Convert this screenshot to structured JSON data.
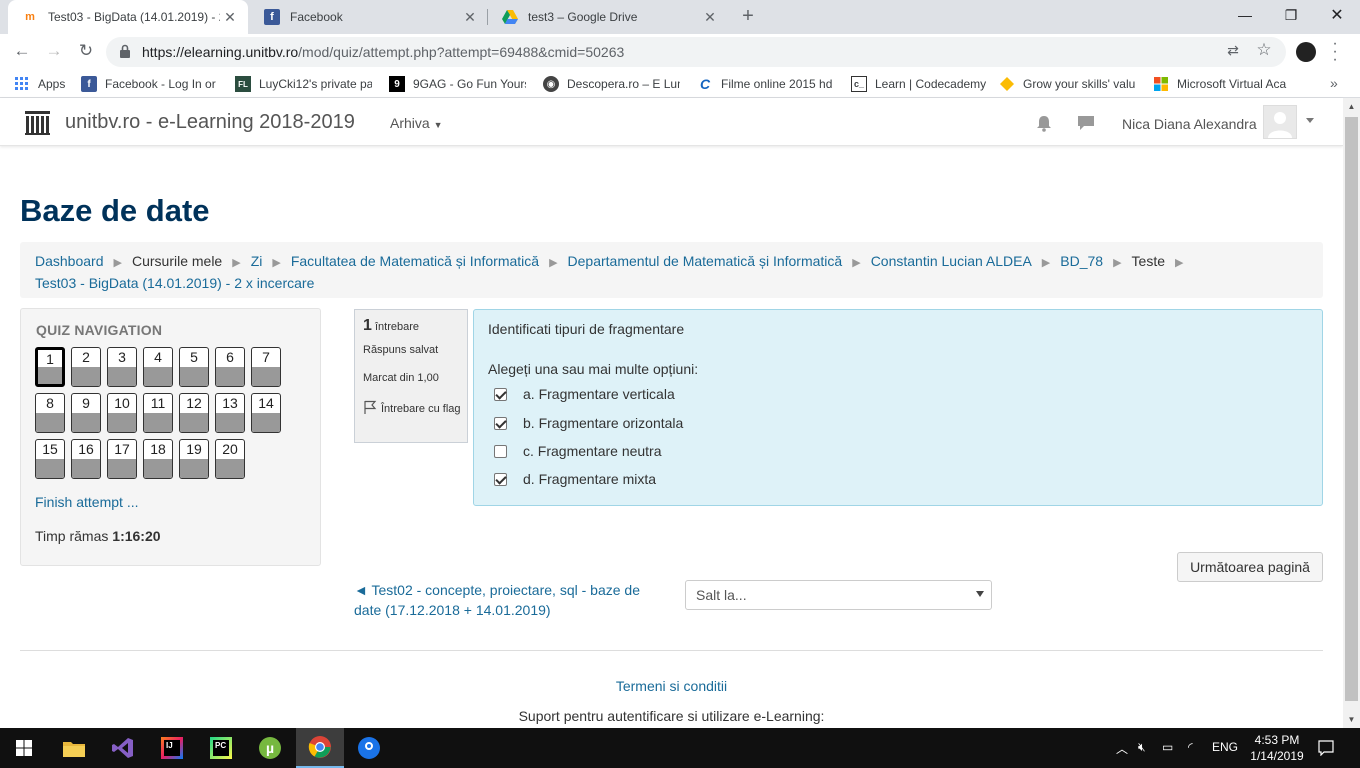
{
  "browser": {
    "tabs": [
      {
        "title": "Test03 - BigData (14.01.2019) - 2",
        "active": true
      },
      {
        "title": "Facebook",
        "active": false
      },
      {
        "title": "test3 – Google Drive",
        "active": false
      }
    ],
    "url_host": "https://elearning.unitbv.ro",
    "url_path": "/mod/quiz/attempt.php?attempt=69488&cmid=50263",
    "bookmarks": [
      "Apps",
      "Facebook - Log In or",
      "LuyCki12's private pa",
      "9GAG - Go Fun Yours",
      "Descopera.ro – E Lum",
      "Filme online 2015 hd",
      "Learn | Codecademy",
      "Grow your skills' valu",
      "Microsoft Virtual Aca"
    ]
  },
  "navbar": {
    "brand": "unitbv.ro - e-Learning 2018-2019",
    "menu": "Arhiva",
    "user_name": "Nica Diana Alexandra"
  },
  "page": {
    "title": "Baze de date",
    "breadcrumb": {
      "dashboard": "Dashboard",
      "my_courses": "Cursurile mele",
      "zi": "Zi",
      "faculty": "Facultatea de Matematică și Informatică",
      "department": "Departamentul de Matematică și Informatică",
      "teacher": "Constantin Lucian ALDEA",
      "course": "BD_78",
      "tests": "Teste",
      "quiz": "Test03 - BigData (14.01.2019) - 2 x incercare"
    }
  },
  "quiz_nav": {
    "title": "QUIZ NAVIGATION",
    "questions": [
      "1",
      "2",
      "3",
      "4",
      "5",
      "6",
      "7",
      "8",
      "9",
      "10",
      "11",
      "12",
      "13",
      "14",
      "15",
      "16",
      "17",
      "18",
      "19",
      "20"
    ],
    "finish": "Finish attempt ...",
    "timer_label": "Timp rămas",
    "timer_value": "1:16:20"
  },
  "question": {
    "number": "1",
    "label": "întrebare",
    "status": "Răspuns salvat",
    "mark": "Marcat din 1,00",
    "flag": "Întrebare cu flag",
    "text": "Identificati tipuri de fragmentare",
    "prompt": "Alegeți una sau mai multe opțiuni:",
    "options": [
      {
        "text": "a. Fragmentare verticala",
        "checked": true
      },
      {
        "text": "b. Fragmentare orizontala",
        "checked": true
      },
      {
        "text": "c. Fragmentare neutra",
        "checked": false
      },
      {
        "text": "d. Fragmentare mixta",
        "checked": true
      }
    ]
  },
  "next_button": "Următoarea pagină",
  "prev_link": "◄ Test02 - concepte, proiectare, sql - baze de date (17.12.2018 + 14.01.2019)",
  "jump_select": "Salt la...",
  "footer": {
    "terms": "Termeni si conditii",
    "support": "Suport pentru autentificare si utilizare e-Learning:"
  },
  "taskbar": {
    "language": "ENG",
    "time": "4:53 PM",
    "date": "1/14/2019"
  },
  "colors": {
    "title": "#00325a",
    "link": "#1a6b99",
    "question_bg": "#def2f8",
    "taskbar": "#101010"
  }
}
